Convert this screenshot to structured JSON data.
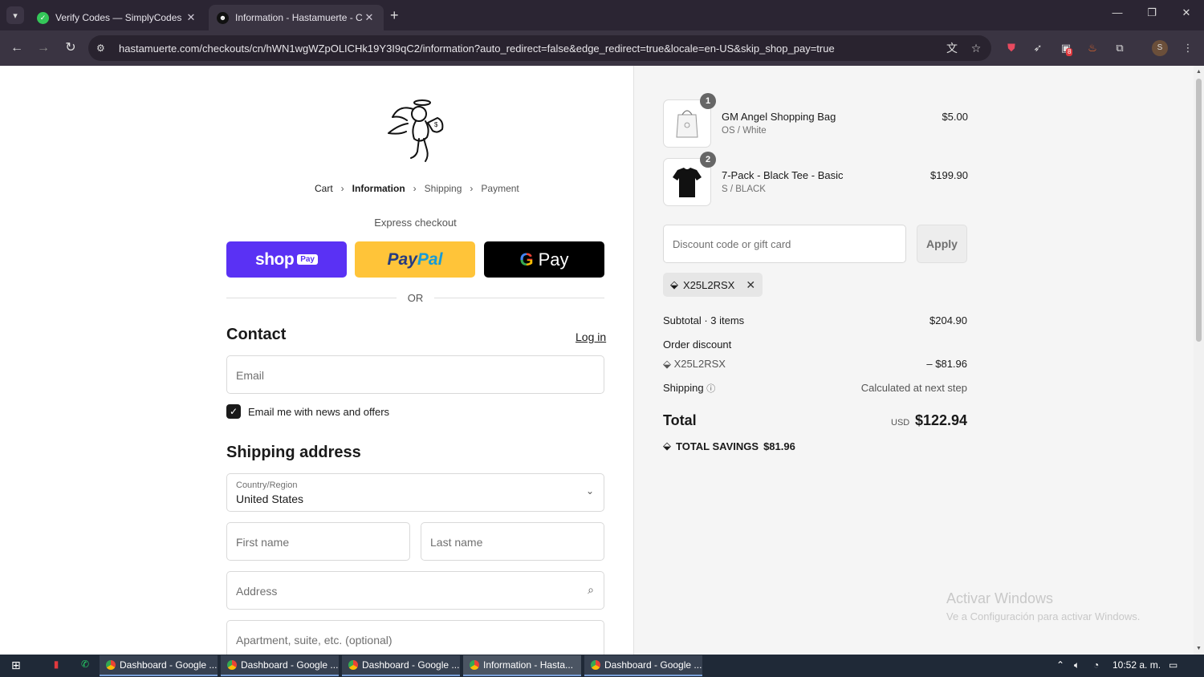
{
  "browser": {
    "tabs": [
      {
        "title": "Verify Codes — SimplyCodes",
        "active": false
      },
      {
        "title": "Information - Hastamuerte - Ch",
        "active": true
      }
    ],
    "url": "hastamuerte.com/checkouts/cn/hWN1wgWZpOLICHk19Y3I9qC2/information?auto_redirect=false&edge_redirect=true&locale=en-US&skip_shop_pay=true",
    "extension_badge": "8",
    "profile_initial": "S"
  },
  "checkout": {
    "breadcrumb": {
      "cart": "Cart",
      "information": "Information",
      "shipping": "Shipping",
      "payment": "Payment"
    },
    "express_checkout_label": "Express checkout",
    "shop_pay": {
      "word": "shop",
      "chip": "Pay"
    },
    "paypal": {
      "part1": "Pay",
      "part2": "Pal"
    },
    "gpay": {
      "g": "G",
      "word": "Pay"
    },
    "or_label": "OR",
    "contact_heading": "Contact",
    "login_link": "Log in",
    "email_placeholder": "Email",
    "newsletter_label": "Email me with news and offers",
    "newsletter_checked": true,
    "shipping_heading": "Shipping address",
    "country_label": "Country/Region",
    "country_value": "United States",
    "first_name_placeholder": "First name",
    "last_name_placeholder": "Last name",
    "address_placeholder": "Address",
    "apartment_placeholder": "Apartment, suite, etc. (optional)"
  },
  "summary": {
    "items": [
      {
        "qty": "1",
        "name": "GM Angel Shopping Bag",
        "variant": "OS / White",
        "price": "$5.00"
      },
      {
        "qty": "2",
        "name": "7-Pack - Black Tee - Basic",
        "variant": "S / BLACK",
        "price": "$199.90"
      }
    ],
    "discount_placeholder": "Discount code or gift card",
    "apply_label": "Apply",
    "applied_code": "X25L2RSX",
    "subtotal_label": "Subtotal · 3 items",
    "subtotal_value": "$204.90",
    "order_discount_label": "Order discount",
    "discount_code": "X25L2RSX",
    "discount_value": "– $81.96",
    "shipping_label": "Shipping",
    "shipping_value": "Calculated at next step",
    "total_label": "Total",
    "currency": "USD",
    "total_value": "$122.94",
    "savings_label": "TOTAL SAVINGS",
    "savings_value": "$81.96"
  },
  "watermark": {
    "line1": "Activar Windows",
    "line2": "Ve a Configuración para activar Windows."
  },
  "taskbar": {
    "apps": [
      {
        "label": "Dashboard - Google ...",
        "active": false
      },
      {
        "label": "Dashboard - Google ...",
        "active": false
      },
      {
        "label": "Dashboard - Google ...",
        "active": false
      },
      {
        "label": "Information - Hasta...",
        "active": true
      },
      {
        "label": "Dashboard - Google ...",
        "active": false
      }
    ],
    "clock": "10:52 a. m."
  },
  "colors": {
    "shop_pay": "#5a31f4",
    "paypal": "#ffc439",
    "gpay": "#000000",
    "summary_bg": "#f5f5f5",
    "chrome_bg": "#2b2533"
  }
}
